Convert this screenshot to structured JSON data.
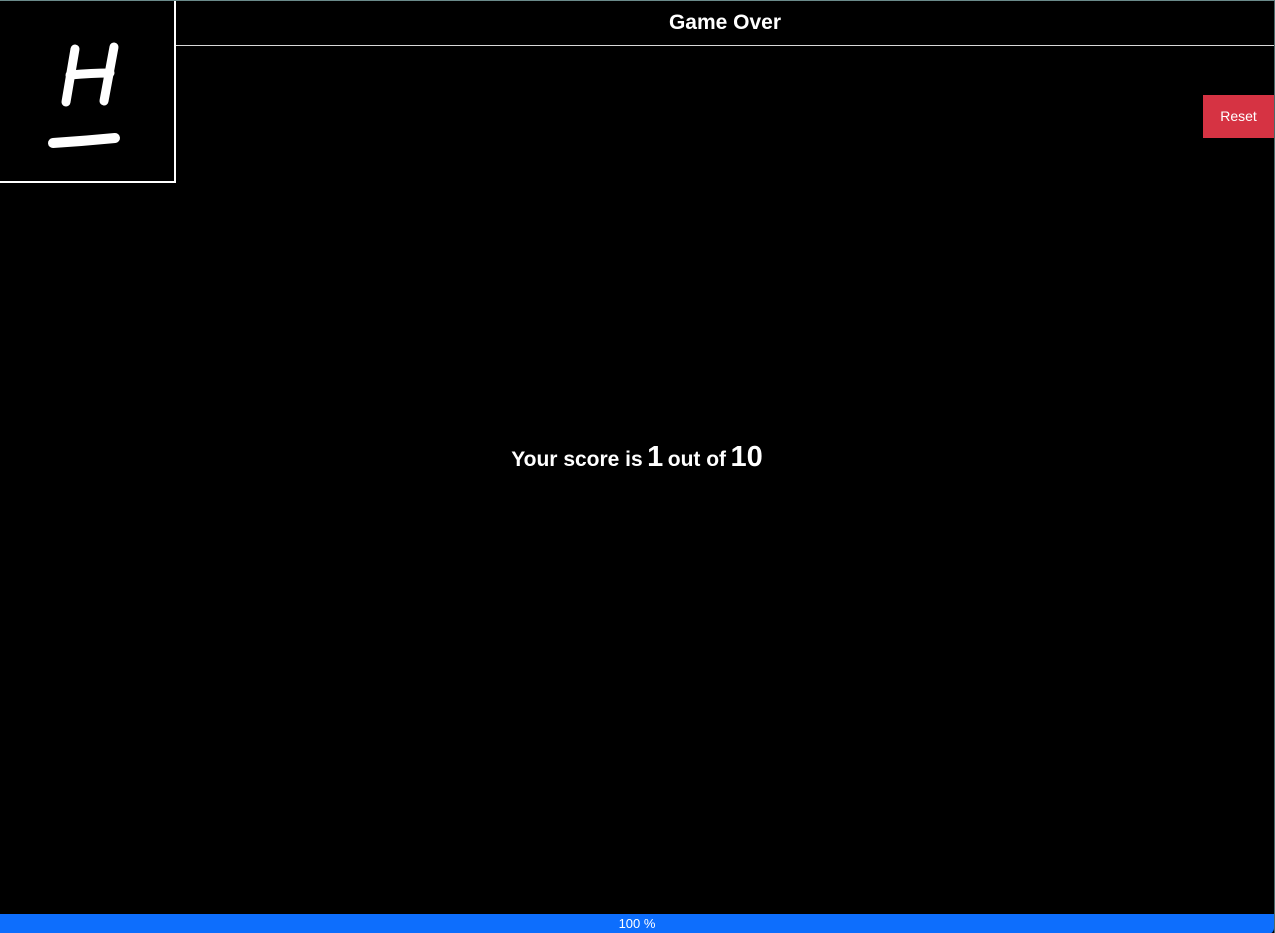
{
  "header": {
    "title": "Game Over"
  },
  "logo": {
    "letter": "H",
    "icon": "handwritten-h-logo"
  },
  "controls": {
    "reset_label": "Reset"
  },
  "result": {
    "prefix": "Your score is",
    "score": "1",
    "middle": "out of",
    "total": "10"
  },
  "progress": {
    "percent": 100,
    "label": "100 %"
  },
  "colors": {
    "background": "#000000",
    "text": "#ffffff",
    "reset_button": "#d63343",
    "progress_fill": "#0d6efd"
  }
}
